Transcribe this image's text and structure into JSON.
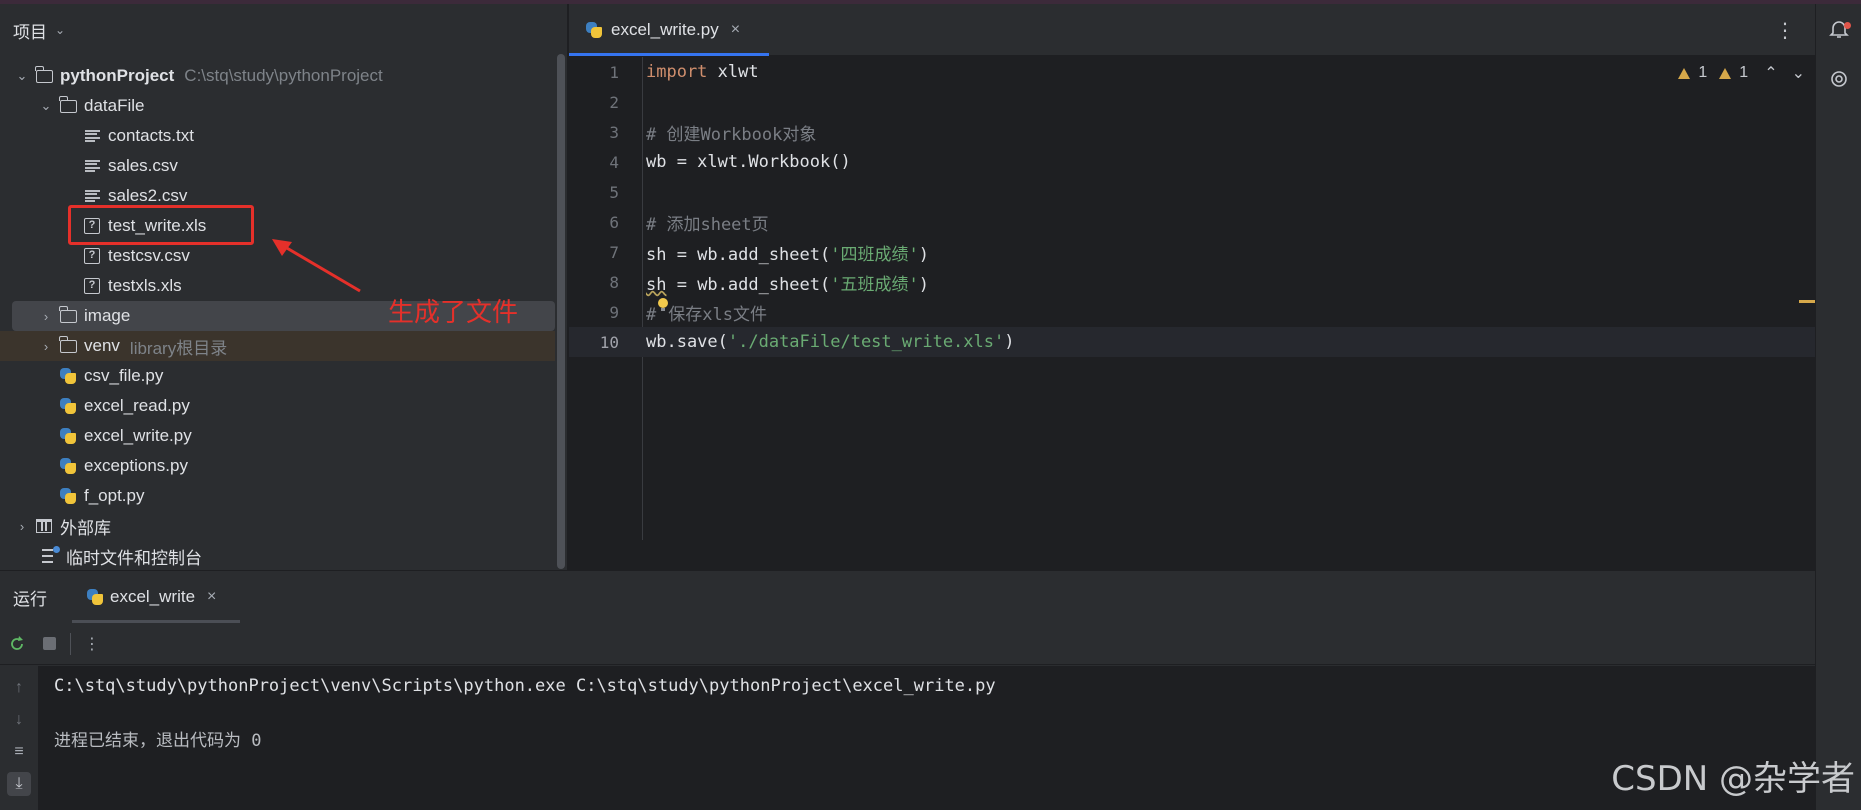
{
  "project_panel": {
    "title": "项目",
    "tree": [
      {
        "name": "pythonProject",
        "hint": "C:\\stq\\study\\pythonProject"
      },
      {
        "name": "dataFile"
      },
      {
        "name": "contacts.txt"
      },
      {
        "name": "sales.csv"
      },
      {
        "name": "sales2.csv"
      },
      {
        "name": "test_write.xls"
      },
      {
        "name": "testcsv.csv"
      },
      {
        "name": "testxls.xls"
      },
      {
        "name": "image"
      },
      {
        "name": "venv",
        "hint": "library根目录"
      },
      {
        "name": "csv_file.py"
      },
      {
        "name": "excel_read.py"
      },
      {
        "name": "excel_write.py"
      },
      {
        "name": "exceptions.py"
      },
      {
        "name": "f_opt.py"
      },
      {
        "name": "外部库"
      },
      {
        "name": "临时文件和控制台"
      }
    ],
    "annotation": "生成了文件"
  },
  "editor": {
    "tab_label": "excel_write.py",
    "tab_close": "×",
    "inspections": {
      "warnings_a": "1",
      "warnings_b": "1"
    },
    "line_numbers": [
      "1",
      "2",
      "3",
      "4",
      "5",
      "6",
      "7",
      "8",
      "9",
      "10"
    ],
    "code": {
      "l1_kw": "import",
      "l1_rest": " xlwt",
      "l3": "# 创建Workbook对象",
      "l4": "wb = xlwt.Workbook()",
      "l6": "# 添加sheet页",
      "l7_a": "sh = wb.add_sheet(",
      "l7_s": "'四班成绩'",
      "l7_b": ")",
      "l8_var": "sh",
      "l8_a": " = wb.add_sheet(",
      "l8_s": "'五班成绩'",
      "l8_b": ")",
      "l9_a": "#",
      "l9_b": "保存xls文件",
      "l10_a": "wb.save(",
      "l10_s": "'./dataFile/test_write.xls'",
      "l10_b": ")"
    }
  },
  "run_panel": {
    "title": "运行",
    "tab_label": "excel_write",
    "tab_close": "×",
    "console": [
      "C:\\stq\\study\\pythonProject\\venv\\Scripts\\python.exe C:\\stq\\study\\pythonProject\\excel_write.py",
      "进程已结束，退出代码为 0"
    ]
  },
  "watermark": "CSDN @杂学者"
}
